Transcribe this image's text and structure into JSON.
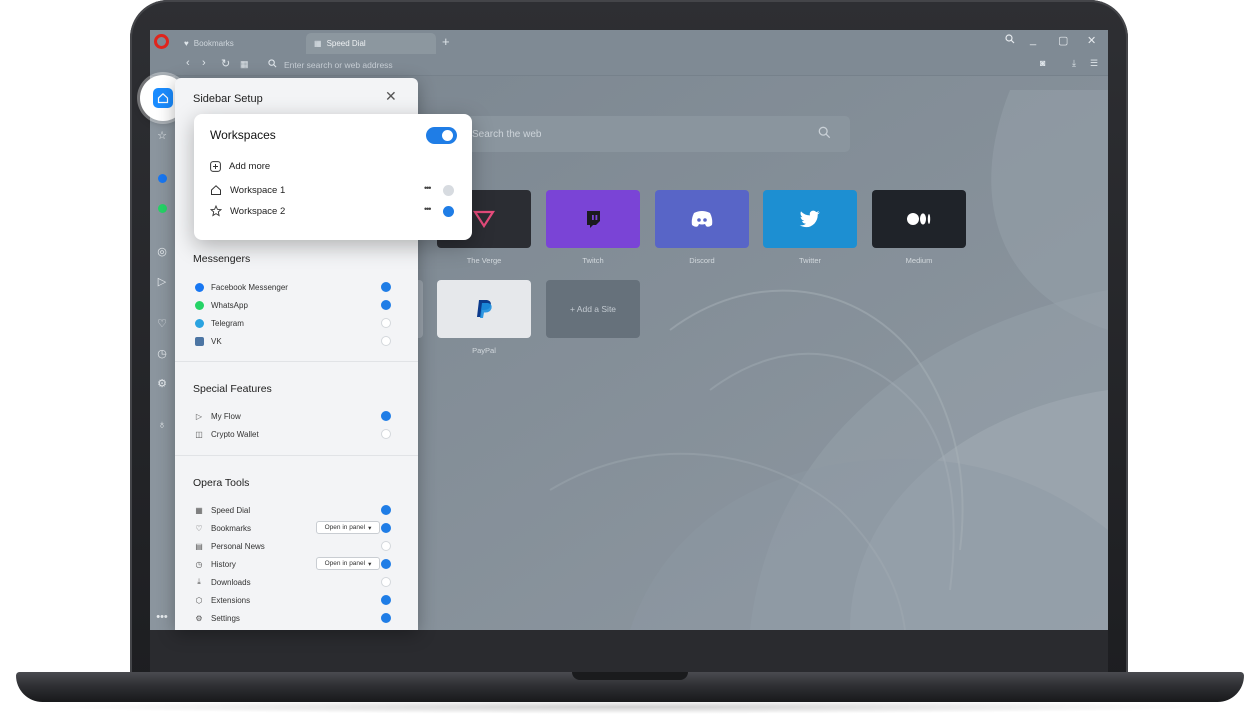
{
  "browser": {
    "tabs": [
      {
        "label": "Bookmarks",
        "icon": "heart-icon",
        "active": false
      },
      {
        "label": "Speed Dial",
        "icon": "grid-icon",
        "active": true
      }
    ],
    "new_tab": "+",
    "address_placeholder": "Enter search or web address"
  },
  "speed_dial": {
    "search_placeholder": "Search the web",
    "tiles_row1": [
      {
        "label": "The Verge",
        "color": "#2b2d33"
      },
      {
        "label": "Twitch",
        "color": "#7a44d6"
      },
      {
        "label": "Discord",
        "color": "#5865c7"
      },
      {
        "label": "Twitter",
        "color": "#1d8fd2"
      },
      {
        "label": "Medium",
        "color": "#1f2329"
      }
    ],
    "tiles_row2": [
      {
        "label": "PayPal",
        "color": "#e6e8eb"
      }
    ],
    "add_site": "+ Add a Site"
  },
  "setup": {
    "title": "Sidebar Setup",
    "close": "✕",
    "workspaces": {
      "title": "Workspaces",
      "enabled": true,
      "add_more": "Add more",
      "items": [
        {
          "label": "Workspace 1",
          "checked": false
        },
        {
          "label": "Workspace 2",
          "checked": true
        }
      ],
      "more": "•••"
    },
    "messengers": {
      "title": "Messengers",
      "items": [
        {
          "label": "Facebook Messenger",
          "checked": true,
          "color": "#1877f2"
        },
        {
          "label": "WhatsApp",
          "checked": true,
          "color": "#25d366"
        },
        {
          "label": "Telegram",
          "checked": false,
          "color": "#2aa3e0"
        },
        {
          "label": "VK",
          "checked": false,
          "color": "#4c75a3"
        }
      ]
    },
    "special": {
      "title": "Special Features",
      "items": [
        {
          "label": "My Flow",
          "checked": true
        },
        {
          "label": "Crypto Wallet",
          "checked": false
        }
      ]
    },
    "tools": {
      "title": "Opera Tools",
      "open_in_panel": "Open in panel",
      "items": [
        {
          "label": "Speed Dial",
          "checked": true
        },
        {
          "label": "Bookmarks",
          "checked": true
        },
        {
          "label": "Personal News",
          "checked": false
        },
        {
          "label": "History",
          "checked": true
        },
        {
          "label": "Downloads",
          "checked": false
        },
        {
          "label": "Extensions",
          "checked": true
        },
        {
          "label": "Settings",
          "checked": true
        }
      ]
    }
  },
  "colors": {
    "accent": "#1f7de6",
    "opera_red": "#e0241c"
  }
}
